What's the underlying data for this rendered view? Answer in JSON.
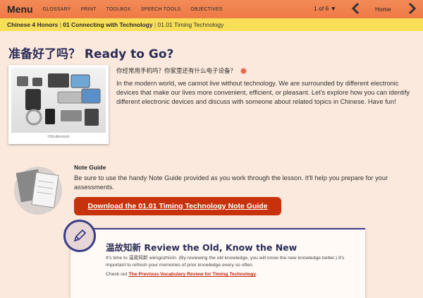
{
  "nav": {
    "menu": "Menu",
    "links": [
      "GLOSSARY",
      "PRINT",
      "TOOLBOX",
      "SPEECH TOOLS",
      "OBJECTIVES"
    ],
    "pager": "1 of 6 ▼",
    "home": "Home",
    "prev_icon": "chevron-left-icon",
    "next_icon": "chevron-right-icon"
  },
  "breadcrumb": {
    "course": "Chinese 4 Honors",
    "module": "01 Connecting with Technology",
    "lesson": "01.01 Timing Technology"
  },
  "page": {
    "title": "准备好了吗？ Ready to Go?",
    "image_credit": "©Shutterstock",
    "question_cn": "你经常用手机吗？你家里还有什么电子设备？",
    "intro": "In the modern world, we cannot live without technology. We are surrounded by different electronic devices that make our lives more convenient, efficient, or pleasant. Let's explore how you can identify different electronic devices and discuss with someone about related topics in Chinese. Have fun!"
  },
  "note_guide": {
    "heading": "Note Guide",
    "text": "Be sure to use the handy Note Guide provided as you work through the lesson. It'll help you prepare for your assessments.",
    "download_label": "Download the 01.01 Timing Technology Note Guide"
  },
  "review": {
    "title": "温故知新 Review the Old, Know the New",
    "text": "It's time to 温故知新 wēngùzhīxīn. (By reviewing the old knowledge, you will know the new knowledge better.) It's important to refresh your memories of prior knowledge every so often.",
    "check_prefix": "Check out ",
    "link": "The Previous Vocabulary Review for Timing Technology",
    "check_suffix": "."
  },
  "colors": {
    "topbar": "#ef7a45",
    "breadcrumb": "#f8df58",
    "background": "#fbe9dd",
    "accent_red": "#c7310c",
    "navy": "#2b2d57"
  }
}
